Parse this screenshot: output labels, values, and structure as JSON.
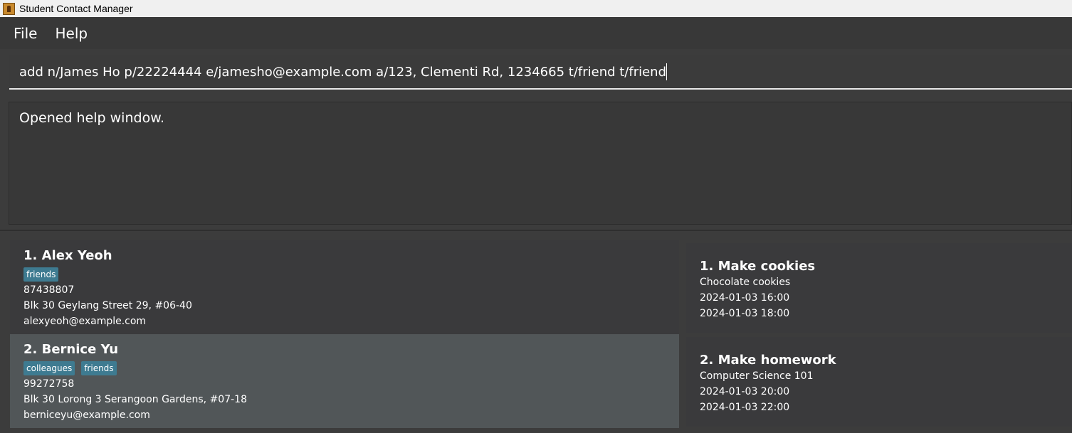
{
  "window": {
    "title": "Student Contact Manager"
  },
  "menu": {
    "file": "File",
    "help": "Help"
  },
  "command": {
    "value": "add n/James Ho p/22224444 e/jamesho@example.com a/123, Clementi Rd, 1234665 t/friend t/friend"
  },
  "result": {
    "message": "Opened help window."
  },
  "persons": [
    {
      "name": "1.  Alex Yeoh",
      "tags": [
        "friends"
      ],
      "phone": "87438807",
      "address": "Blk 30 Geylang Street 29, #06-40",
      "email": "alexyeoh@example.com"
    },
    {
      "name": "2.  Bernice Yu",
      "tags": [
        "colleagues",
        "friends"
      ],
      "phone": "99272758",
      "address": "Blk 30 Lorong 3 Serangoon Gardens, #07-18",
      "email": "berniceyu@example.com"
    }
  ],
  "events": [
    {
      "name": "1.  Make cookies",
      "description": "Chocolate cookies",
      "start": "2024-01-03 16:00",
      "end": "2024-01-03 18:00"
    },
    {
      "name": "2.  Make homework",
      "description": "Computer Science 101",
      "start": "2024-01-03 20:00",
      "end": "2024-01-03 22:00"
    }
  ]
}
